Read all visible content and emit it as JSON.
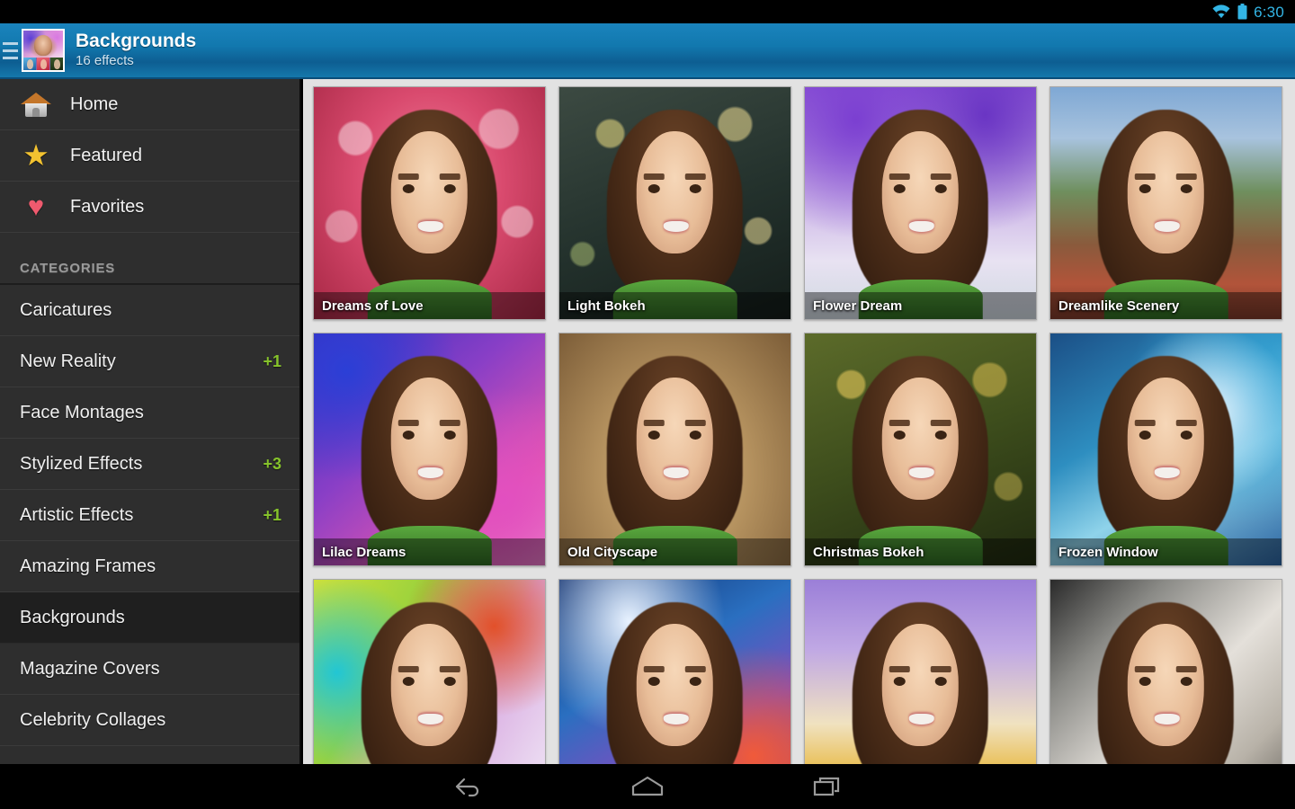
{
  "status_bar": {
    "wifi_icon": "wifi-icon",
    "battery_icon": "battery-icon",
    "time": "6:30",
    "accent_color": "#33b5e5"
  },
  "header": {
    "menu_icon": "hamburger-menu-icon",
    "app_icon": "app-collage-icon",
    "title": "Backgrounds",
    "subtitle": "16 effects",
    "background_color": "#1278ae"
  },
  "sidebar": {
    "nav_items": [
      {
        "label": "Home",
        "icon": "house-icon"
      },
      {
        "label": "Featured",
        "icon": "star-icon"
      },
      {
        "label": "Favorites",
        "icon": "heart-icon"
      }
    ],
    "categories_header": "CATEGORIES",
    "badge_color": "#86c32b",
    "categories": [
      {
        "label": "Caricatures",
        "badge": "",
        "selected": false
      },
      {
        "label": "New Reality",
        "badge": "+1",
        "selected": false
      },
      {
        "label": "Face Montages",
        "badge": "",
        "selected": false
      },
      {
        "label": "Stylized Effects",
        "badge": "+3",
        "selected": false
      },
      {
        "label": "Artistic Effects",
        "badge": "+1",
        "selected": false
      },
      {
        "label": "Amazing Frames",
        "badge": "",
        "selected": false
      },
      {
        "label": "Backgrounds",
        "badge": "",
        "selected": true
      },
      {
        "label": "Magazine Covers",
        "badge": "",
        "selected": false
      },
      {
        "label": "Celebrity Collages",
        "badge": "",
        "selected": false
      }
    ]
  },
  "grid": {
    "tiles": [
      {
        "label": "Dreams of Love",
        "show_label": true
      },
      {
        "label": "Light Bokeh",
        "show_label": true
      },
      {
        "label": "Flower Dream",
        "show_label": true
      },
      {
        "label": "Dreamlike Scenery",
        "show_label": true
      },
      {
        "label": "Lilac Dreams",
        "show_label": true
      },
      {
        "label": "Old Cityscape",
        "show_label": true
      },
      {
        "label": "Christmas Bokeh",
        "show_label": true
      },
      {
        "label": "Frozen Window",
        "show_label": true
      },
      {
        "label": "",
        "show_label": false
      },
      {
        "label": "",
        "show_label": false
      },
      {
        "label": "",
        "show_label": false
      },
      {
        "label": "",
        "show_label": false
      }
    ]
  },
  "nav_bar": {
    "back_icon": "back-arrow-icon",
    "home_icon": "home-outline-icon",
    "recents_icon": "recent-apps-icon"
  }
}
